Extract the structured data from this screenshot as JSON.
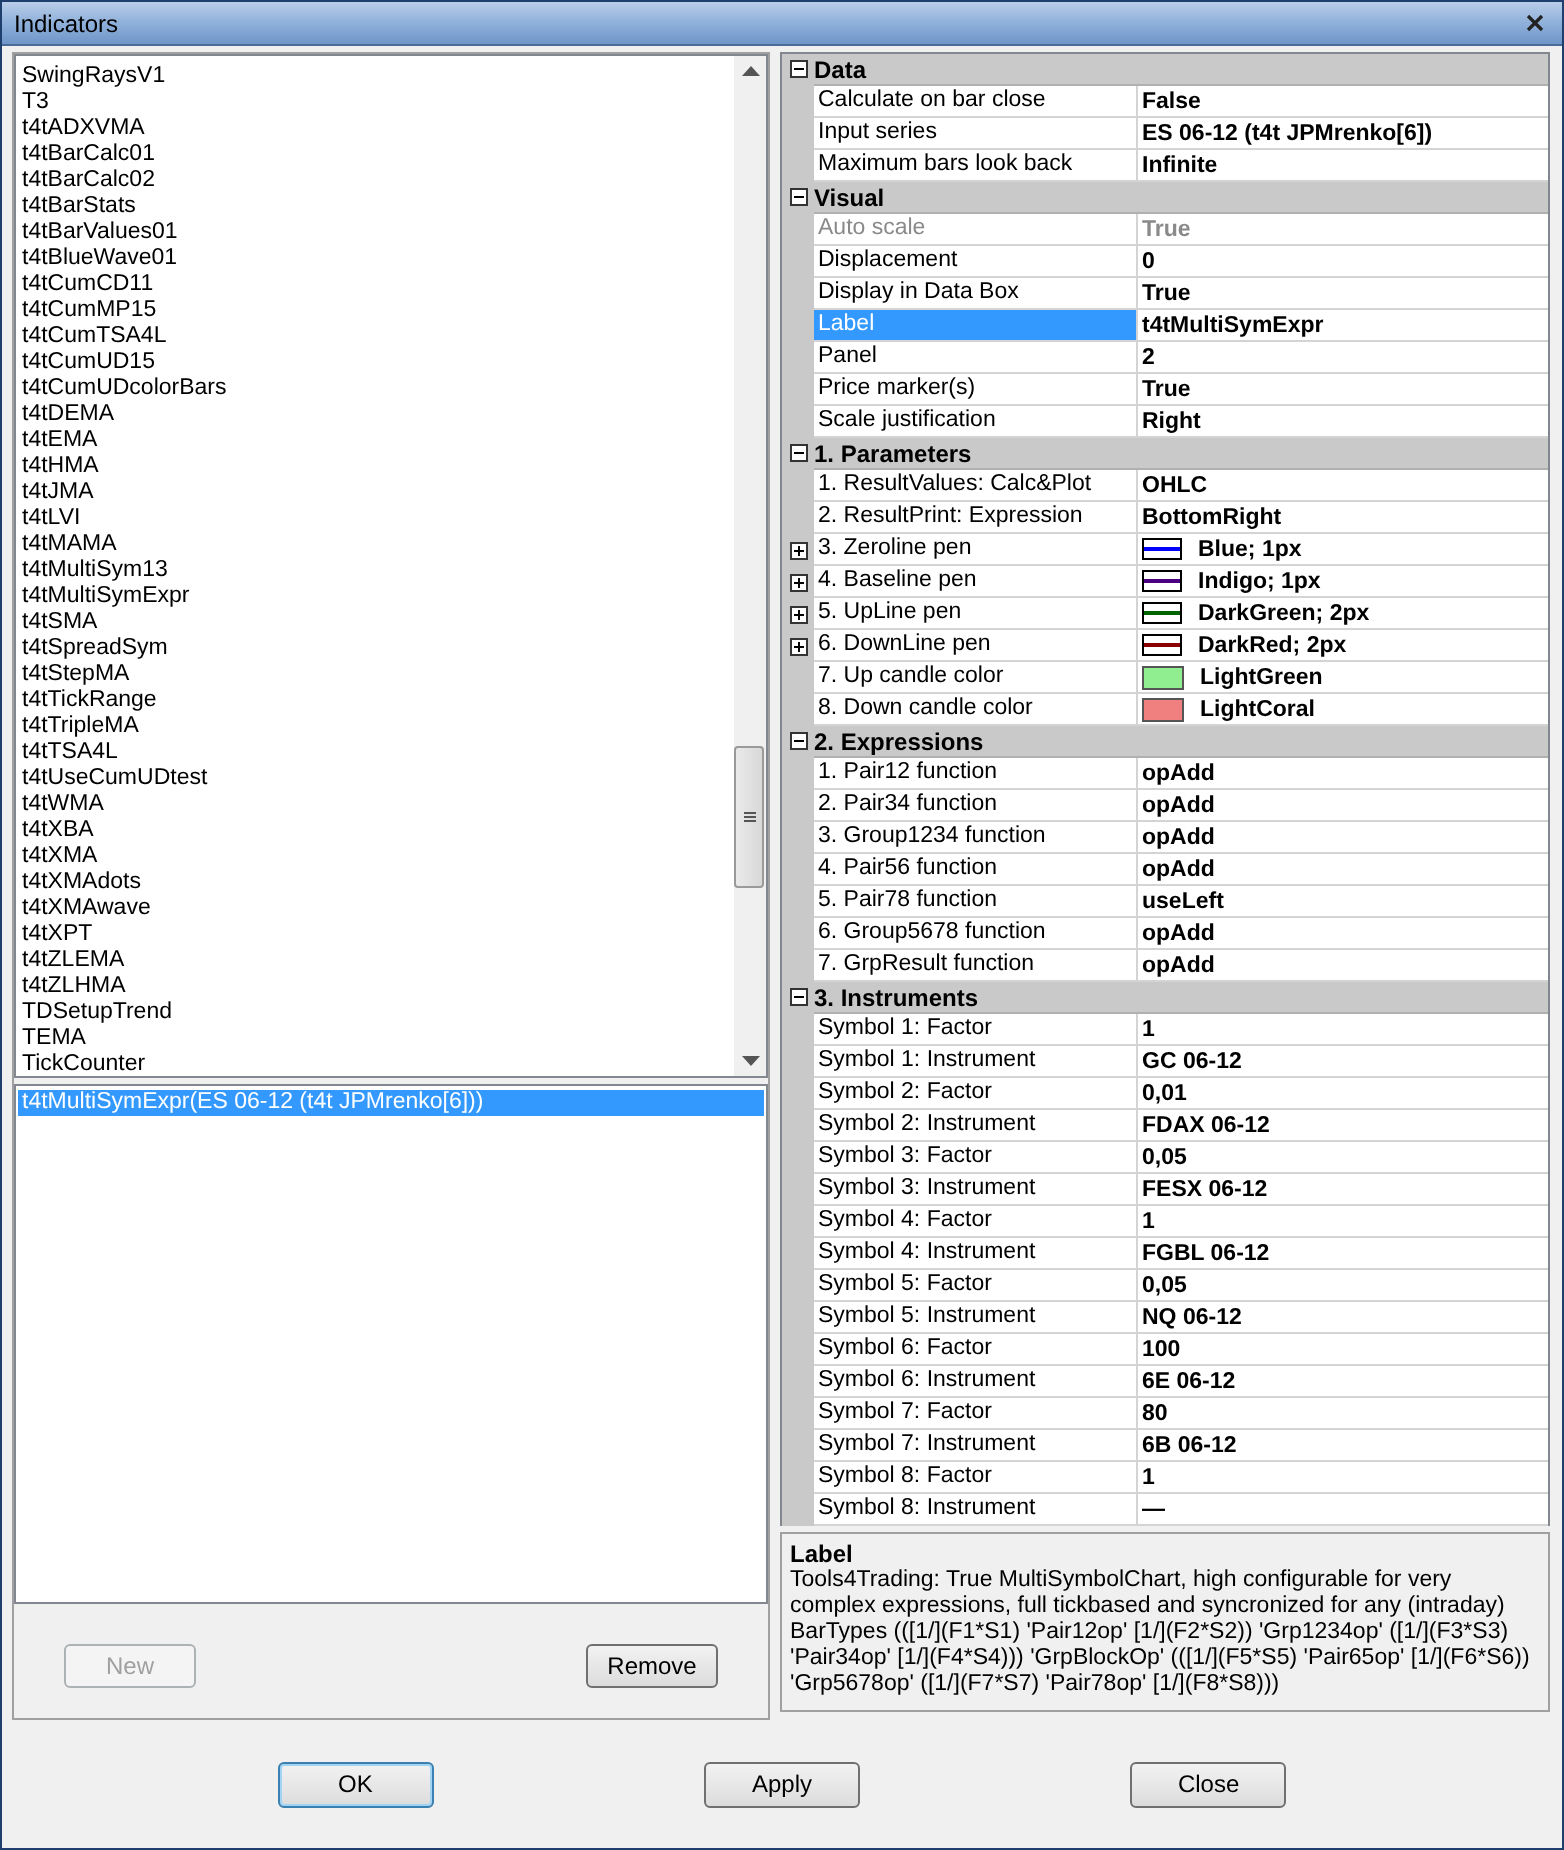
{
  "window": {
    "title": "Indicators"
  },
  "indicator_list": [
    "SwingRaysV1",
    "T3",
    "t4tADXVMA",
    "t4tBarCalc01",
    "t4tBarCalc02",
    "t4tBarStats",
    "t4tBarValues01",
    "t4tBlueWave01",
    "t4tCumCD11",
    "t4tCumMP15",
    "t4tCumTSA4L",
    "t4tCumUD15",
    "t4tCumUDcolorBars",
    "t4tDEMA",
    "t4tEMA",
    "t4tHMA",
    "t4tJMA",
    "t4tLVI",
    "t4tMAMA",
    "t4tMultiSym13",
    "t4tMultiSymExpr",
    "t4tSMA",
    "t4tSpreadSym",
    "t4tStepMA",
    "t4tTickRange",
    "t4tTripleMA",
    "t4tTSA4L",
    "t4tUseCumUDtest",
    "t4tWMA",
    "t4tXBA",
    "t4tXMA",
    "t4tXMAdots",
    "t4tXMAwave",
    "t4tXPT",
    "t4tZLEMA",
    "t4tZLHMA",
    "TDSetupTrend",
    "TEMA",
    "TickCounter"
  ],
  "applied_list": [
    {
      "label": "t4tMultiSymExpr(ES 06-12 (t4t JPMrenko[6]))",
      "selected": true
    }
  ],
  "left_buttons": [
    {
      "label": "New",
      "disabled": true
    },
    {
      "label": "Remove",
      "disabled": false
    }
  ],
  "properties": [
    {
      "category": "Data",
      "expanded": true,
      "rows": [
        {
          "kind": "text",
          "label": "Calculate on bar close",
          "value": "False",
          "selected": false,
          "disabled": false
        },
        {
          "kind": "text",
          "label": "Input series",
          "value": "ES 06-12 (t4t JPMrenko[6])",
          "selected": false,
          "disabled": false
        },
        {
          "kind": "text",
          "label": "Maximum bars look back",
          "value": "Infinite",
          "selected": false,
          "disabled": false
        }
      ]
    },
    {
      "category": "Visual",
      "expanded": true,
      "rows": [
        {
          "kind": "text",
          "label": "Auto scale",
          "value": "True",
          "selected": false,
          "disabled": true
        },
        {
          "kind": "text",
          "label": "Displacement",
          "value": "0",
          "selected": false,
          "disabled": false
        },
        {
          "kind": "text",
          "label": "Display in Data Box",
          "value": "True",
          "selected": false,
          "disabled": false
        },
        {
          "kind": "text",
          "label": "Label",
          "value": "t4tMultiSymExpr",
          "selected": true,
          "disabled": false
        },
        {
          "kind": "text",
          "label": "Panel",
          "value": "2",
          "selected": false,
          "disabled": false
        },
        {
          "kind": "text",
          "label": "Price marker(s)",
          "value": "True",
          "selected": false,
          "disabled": false
        },
        {
          "kind": "text",
          "label": "Scale justification",
          "value": "Right",
          "selected": false,
          "disabled": false
        }
      ]
    },
    {
      "category": "1. Parameters",
      "expanded": true,
      "rows": [
        {
          "kind": "text",
          "label": "1. ResultValues: Calc&Plot",
          "value": "OHLC",
          "selected": false,
          "disabled": false
        },
        {
          "kind": "text",
          "label": "2. ResultPrint: Expression",
          "value": "BottomRight",
          "selected": false,
          "disabled": false
        },
        {
          "kind": "pen",
          "label": "3. Zeroline pen",
          "value": "Blue; 1px",
          "color": "#0000ff",
          "selected": false,
          "disabled": false
        },
        {
          "kind": "pen",
          "label": "4. Baseline pen",
          "value": "Indigo; 1px",
          "color": "#4b0082",
          "selected": false,
          "disabled": false
        },
        {
          "kind": "pen",
          "label": "5. UpLine pen",
          "value": "DarkGreen; 2px",
          "color": "#006400",
          "selected": false,
          "disabled": false
        },
        {
          "kind": "pen",
          "label": "6. DownLine pen",
          "value": "DarkRed; 2px",
          "color": "#8b0000",
          "selected": false,
          "disabled": false
        },
        {
          "kind": "swatch",
          "label": "7. Up candle color",
          "value": "LightGreen",
          "color": "#90ee90",
          "selected": false,
          "disabled": false
        },
        {
          "kind": "swatch",
          "label": "8. Down candle color",
          "value": "LightCoral",
          "color": "#f08080",
          "selected": false,
          "disabled": false
        }
      ]
    },
    {
      "category": "2. Expressions",
      "expanded": true,
      "rows": [
        {
          "kind": "text",
          "label": "1. Pair12 function",
          "value": "opAdd",
          "selected": false,
          "disabled": false
        },
        {
          "kind": "text",
          "label": "2. Pair34 function",
          "value": "opAdd",
          "selected": false,
          "disabled": false
        },
        {
          "kind": "text",
          "label": "3. Group1234 function",
          "value": "opAdd",
          "selected": false,
          "disabled": false
        },
        {
          "kind": "text",
          "label": "4. Pair56 function",
          "value": "opAdd",
          "selected": false,
          "disabled": false
        },
        {
          "kind": "text",
          "label": "5. Pair78 function",
          "value": "useLeft",
          "selected": false,
          "disabled": false
        },
        {
          "kind": "text",
          "label": "6. Group5678 function",
          "value": "opAdd",
          "selected": false,
          "disabled": false
        },
        {
          "kind": "text",
          "label": "7. GrpResult function",
          "value": "opAdd",
          "selected": false,
          "disabled": false
        }
      ]
    },
    {
      "category": "3. Instruments",
      "expanded": true,
      "rows": [
        {
          "kind": "text",
          "label": "Symbol 1: Factor",
          "value": "1",
          "selected": false,
          "disabled": false
        },
        {
          "kind": "text",
          "label": "Symbol 1: Instrument",
          "value": "GC 06-12",
          "selected": false,
          "disabled": false
        },
        {
          "kind": "text",
          "label": "Symbol 2: Factor",
          "value": "0,01",
          "selected": false,
          "disabled": false
        },
        {
          "kind": "text",
          "label": "Symbol 2: Instrument",
          "value": "FDAX 06-12",
          "selected": false,
          "disabled": false
        },
        {
          "kind": "text",
          "label": "Symbol 3: Factor",
          "value": "0,05",
          "selected": false,
          "disabled": false
        },
        {
          "kind": "text",
          "label": "Symbol 3: Instrument",
          "value": "FESX 06-12",
          "selected": false,
          "disabled": false
        },
        {
          "kind": "text",
          "label": "Symbol 4: Factor",
          "value": "1",
          "selected": false,
          "disabled": false
        },
        {
          "kind": "text",
          "label": "Symbol 4: Instrument",
          "value": "FGBL 06-12",
          "selected": false,
          "disabled": false
        },
        {
          "kind": "text",
          "label": "Symbol 5: Factor",
          "value": "0,05",
          "selected": false,
          "disabled": false
        },
        {
          "kind": "text",
          "label": "Symbol 5: Instrument",
          "value": "NQ 06-12",
          "selected": false,
          "disabled": false
        },
        {
          "kind": "text",
          "label": "Symbol 6: Factor",
          "value": "100",
          "selected": false,
          "disabled": false
        },
        {
          "kind": "text",
          "label": "Symbol 6: Instrument",
          "value": "6E 06-12",
          "selected": false,
          "disabled": false
        },
        {
          "kind": "text",
          "label": "Symbol 7: Factor",
          "value": "80",
          "selected": false,
          "disabled": false
        },
        {
          "kind": "text",
          "label": "Symbol 7: Instrument",
          "value": "6B 06-12",
          "selected": false,
          "disabled": false
        },
        {
          "kind": "text",
          "label": "Symbol 8: Factor",
          "value": "1",
          "selected": false,
          "disabled": false
        },
        {
          "kind": "text",
          "label": "Symbol 8: Instrument",
          "value": "—",
          "selected": false,
          "disabled": false
        }
      ]
    }
  ],
  "description": {
    "title": "Label",
    "text": "Tools4Trading: True MultiSymbolChart, high configurable for very complex expressions, full tickbased and syncronized for any (intraday) BarTypes  (([1/](F1*S1) 'Pair12op' [1/](F2*S2)) 'Grp1234op' ([1/](F3*S3) 'Pair34op' [1/](F4*S4))) 'GrpBlockOp' (([1/](F5*S5) 'Pair65op' [1/](F6*S6)) 'Grp5678op' ([1/](F7*S7) 'Pair78op' [1/](F8*S8)))"
  },
  "dialog_buttons": [
    {
      "label": "OK",
      "default": true
    },
    {
      "label": "Apply",
      "default": false
    },
    {
      "label": "Close",
      "default": false
    }
  ]
}
